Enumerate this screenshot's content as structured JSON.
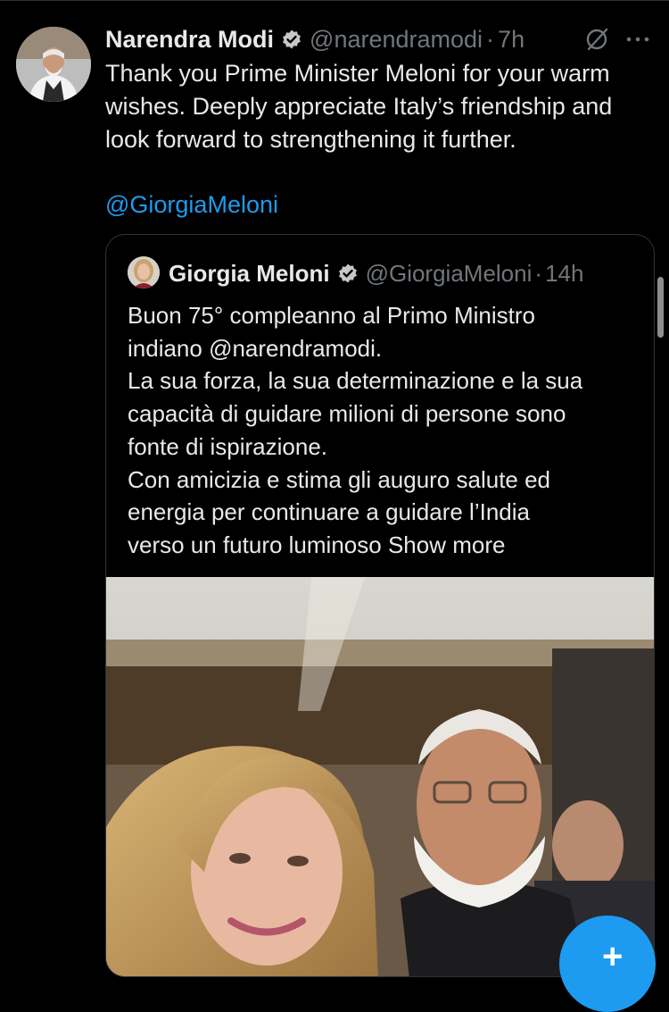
{
  "tweet": {
    "author_name": "Narendra Modi",
    "handle": "@narendramodi",
    "separator": "·",
    "time": "7h",
    "text": "Thank you Prime Minister Meloni for your warm\nwishes. Deeply appreciate Italy’s friendship and\nlook forward to strengthening it further.",
    "mention": "@GiorgiaMeloni",
    "more_label": "···"
  },
  "quote": {
    "author_name": "Giorgia Meloni",
    "handle": "@GiorgiaMeloni",
    "separator": "·",
    "time": "14h",
    "lines": [
      "Buon 75° compleanno al Primo Ministro",
      "indiano @narendramodi.",
      "La sua forza, la sua determinazione e la sua",
      "capacità di guidare milioni di persone sono",
      "fonte di ispirazione.",
      "Con amicizia e stima gli auguro salute ed",
      "energia per continuare a guidare l’India",
      "verso un futuro luminoso"
    ],
    "show_more": "Show more"
  },
  "fab": {
    "label": "+"
  },
  "colors": {
    "background": "#000000",
    "text": "#e7e9ea",
    "muted": "#71767b",
    "accent": "#1d9bf0",
    "border": "#2f3336"
  },
  "icons": [
    "verified-badge-icon",
    "grok-icon",
    "more-icon",
    "compose-plus-icon"
  ]
}
